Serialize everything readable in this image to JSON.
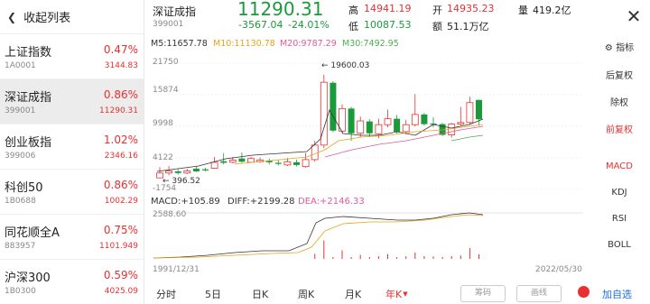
{
  "sidebar": {
    "title": "收起列表",
    "items": [
      {
        "name": "上证指数",
        "code": "1A0001",
        "pct": "0.47%",
        "price": "3144.83"
      },
      {
        "name": "深证成指",
        "code": "399001",
        "pct": "0.86%",
        "price": "11290.31"
      },
      {
        "name": "创业板指",
        "code": "399006",
        "pct": "1.02%",
        "price": "2346.16"
      },
      {
        "name": "科创50",
        "code": "1B0688",
        "pct": "0.86%",
        "price": "1002.29"
      },
      {
        "name": "同花顺全A",
        "code": "883957",
        "pct": "0.75%",
        "price": "1101.949"
      },
      {
        "name": "沪深300",
        "code": "1B0300",
        "pct": "0.59%",
        "price": "4025.09"
      }
    ]
  },
  "header": {
    "name": "深证成指",
    "code": "399001",
    "price": "11290.31",
    "change": "-3567.04",
    "change_pct": "-24.01%",
    "high_label": "高",
    "high": "14941.19",
    "low_label": "低",
    "low": "10087.53",
    "open_label": "开",
    "open": "14935.23",
    "amount_label": "额",
    "amount": "51.1万亿",
    "volume_label": "量",
    "volume": "419.2亿",
    "close_symbol": "✕"
  },
  "ma_legend": {
    "m5": "M5:11657.78",
    "m10": "M10:11130.78",
    "m20": "M20:9787.29",
    "m30": "M30:7492.95"
  },
  "price_axis": [
    "21750",
    "15874",
    "9998",
    "4122",
    "-1754"
  ],
  "annotations": {
    "high": "19600.03",
    "low": "396.52"
  },
  "macd_legend": {
    "macd": "MACD:+105.89",
    "diff": "DIFF:+2199.28",
    "dea": "DEA:+2146.33",
    "axis_top": "2588.60"
  },
  "date_range": {
    "start": "1991/12/31",
    "end": "2022/05/30"
  },
  "right_panel": {
    "indicator": "指标",
    "options": [
      "后复权",
      "除权",
      "前复权"
    ],
    "indicators": [
      "MACD",
      "KDJ",
      "RSI",
      "BOLL"
    ]
  },
  "periods": [
    "分时",
    "5日",
    "日K",
    "周K",
    "月K",
    "年K"
  ],
  "bottom_buttons": {
    "chips": "筹码",
    "draw": "画线",
    "add": "加自选"
  },
  "colors": {
    "up": "#e93030",
    "down": "#1a9a3b",
    "m5": "#333333",
    "m10": "#e8a21a",
    "m20": "#e05a9a",
    "m30": "#4caf50",
    "accent_blue": "#1e6ee8"
  },
  "chart_data": {
    "type": "candlestick",
    "ylim": [
      -1754,
      21750
    ],
    "candles": [
      {
        "o": 400,
        "c": 1300,
        "h": 2400,
        "l": 396
      },
      {
        "o": 1300,
        "c": 1700,
        "h": 2600,
        "l": 900
      },
      {
        "o": 1600,
        "c": 1300,
        "h": 2000,
        "l": 1000
      },
      {
        "o": 1300,
        "c": 1700,
        "h": 2100,
        "l": 1100
      },
      {
        "o": 2100,
        "c": 1600,
        "h": 2500,
        "l": 1500
      },
      {
        "o": 2000,
        "c": 1800,
        "h": 2300,
        "l": 1600
      },
      {
        "o": 2200,
        "c": 3300,
        "h": 4300,
        "l": 2100
      },
      {
        "o": 3500,
        "c": 3200,
        "h": 5000,
        "l": 2900
      },
      {
        "o": 3300,
        "c": 3700,
        "h": 4300,
        "l": 3100
      },
      {
        "o": 4000,
        "c": 3400,
        "h": 5100,
        "l": 3200
      },
      {
        "o": 3300,
        "c": 4000,
        "h": 4300,
        "l": 3200
      },
      {
        "o": 3400,
        "c": 3700,
        "h": 4200,
        "l": 3200
      },
      {
        "o": 3600,
        "c": 3300,
        "h": 4000,
        "l": 2900
      },
      {
        "o": 3200,
        "c": 3000,
        "h": 3700,
        "l": 2700
      },
      {
        "o": 2800,
        "c": 3400,
        "h": 4100,
        "l": 2600
      },
      {
        "o": 3300,
        "c": 2800,
        "h": 3800,
        "l": 2500
      },
      {
        "o": 2500,
        "c": 3800,
        "h": 5000,
        "l": 2300
      },
      {
        "o": 3800,
        "c": 6500,
        "h": 7300,
        "l": 3400
      },
      {
        "o": 6500,
        "c": 18200,
        "h": 19600,
        "l": 5900
      },
      {
        "o": 18100,
        "c": 9200,
        "h": 18400,
        "l": 8900
      },
      {
        "o": 9100,
        "c": 13300,
        "h": 14100,
        "l": 8700
      },
      {
        "o": 13300,
        "c": 8700,
        "h": 13600,
        "l": 7300
      },
      {
        "o": 8700,
        "c": 11000,
        "h": 11800,
        "l": 8000
      },
      {
        "o": 10900,
        "c": 8700,
        "h": 11300,
        "l": 8000
      },
      {
        "o": 8600,
        "c": 10300,
        "h": 11400,
        "l": 7800
      },
      {
        "o": 10300,
        "c": 11400,
        "h": 13100,
        "l": 9800
      },
      {
        "o": 11400,
        "c": 9000,
        "h": 12100,
        "l": 8700
      },
      {
        "o": 9000,
        "c": 10300,
        "h": 11200,
        "l": 8500
      },
      {
        "o": 10300,
        "c": 12200,
        "h": 16000,
        "l": 10000
      },
      {
        "o": 12200,
        "c": 10400,
        "h": 12500,
        "l": 10100
      },
      {
        "o": 10500,
        "c": 10300,
        "h": 11700,
        "l": 9800
      },
      {
        "o": 10400,
        "c": 8400,
        "h": 10600,
        "l": 8200
      },
      {
        "o": 8400,
        "c": 10400,
        "h": 10600,
        "l": 7900
      },
      {
        "o": 10400,
        "c": 10700,
        "h": 13600,
        "l": 10100
      },
      {
        "o": 10700,
        "c": 14400,
        "h": 15500,
        "l": 10300
      },
      {
        "o": 14900,
        "c": 11300,
        "h": 14950,
        "l": 10100
      }
    ]
  }
}
